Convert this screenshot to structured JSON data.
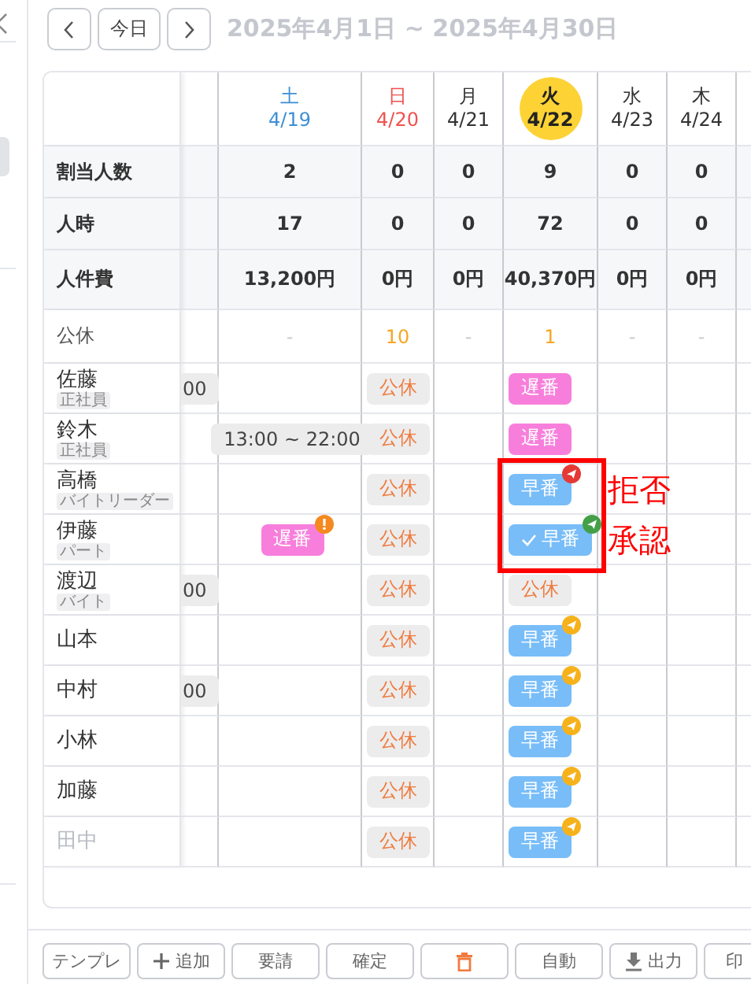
{
  "nav": {
    "today": "今日",
    "range": "2025年4月1日 ~ 2025年4月30日"
  },
  "days": [
    {
      "dow": "土",
      "date": "4/19",
      "kind": "sat",
      "selected": false
    },
    {
      "dow": "日",
      "date": "4/20",
      "kind": "sun",
      "selected": false
    },
    {
      "dow": "月",
      "date": "4/21",
      "kind": "weekday",
      "selected": false
    },
    {
      "dow": "火",
      "date": "4/22",
      "kind": "weekday",
      "selected": true
    },
    {
      "dow": "水",
      "date": "4/23",
      "kind": "weekday",
      "selected": false
    },
    {
      "dow": "木",
      "date": "4/24",
      "kind": "weekday",
      "selected": false
    }
  ],
  "summary": [
    {
      "label": "割当人数",
      "values": [
        "2",
        "0",
        "0",
        "9",
        "0",
        "0"
      ]
    },
    {
      "label": "人時",
      "values": [
        "17",
        "0",
        "0",
        "72",
        "0",
        "0"
      ]
    },
    {
      "label": "人件費",
      "values": [
        "13,200円",
        "0円",
        "0円",
        "40,370円",
        "0円",
        "0円"
      ]
    }
  ],
  "holidays": {
    "label": "公休",
    "cells": [
      {
        "text": "-",
        "highlight": false
      },
      {
        "text": "10",
        "highlight": true
      },
      {
        "text": "-",
        "highlight": false
      },
      {
        "text": "1",
        "highlight": true
      },
      {
        "text": "-",
        "highlight": false
      },
      {
        "text": "-",
        "highlight": false
      }
    ]
  },
  "employees": [
    {
      "name": "佐藤",
      "role": "正社員",
      "inactive": false,
      "partial": "00",
      "shifts": [
        {
          "kind": "empty"
        },
        {
          "label": "公休",
          "kind": "off"
        },
        {
          "kind": "empty"
        },
        {
          "label": "遅番",
          "kind": "late"
        },
        {
          "kind": "empty"
        },
        {
          "kind": "empty"
        }
      ]
    },
    {
      "name": "鈴木",
      "role": "正社員",
      "inactive": false,
      "shifts": [
        {
          "label": "13:00 ~ 22:00",
          "kind": "time"
        },
        {
          "label": "公休",
          "kind": "off"
        },
        {
          "kind": "empty"
        },
        {
          "label": "遅番",
          "kind": "late"
        },
        {
          "kind": "empty"
        },
        {
          "kind": "empty"
        }
      ]
    },
    {
      "name": "高橋",
      "role": "バイトリーダー",
      "inactive": false,
      "note": "拒否",
      "shifts": [
        {
          "kind": "empty"
        },
        {
          "label": "公休",
          "kind": "off"
        },
        {
          "kind": "empty"
        },
        {
          "label": "早番",
          "kind": "early",
          "checked": false,
          "badge": {
            "kind": "send",
            "color": "#e53935"
          }
        },
        {
          "kind": "empty"
        },
        {
          "kind": "empty"
        }
      ]
    },
    {
      "name": "伊藤",
      "role": "パート",
      "inactive": false,
      "note": "承認",
      "shifts": [
        {
          "label": "遅番",
          "kind": "late",
          "badge": {
            "kind": "alert",
            "color": "#f5891f"
          }
        },
        {
          "label": "公休",
          "kind": "off"
        },
        {
          "kind": "empty"
        },
        {
          "label": "早番",
          "kind": "early",
          "checked": true,
          "badge": {
            "kind": "send",
            "color": "#43a047"
          }
        },
        {
          "kind": "empty"
        },
        {
          "kind": "empty"
        }
      ]
    },
    {
      "name": "渡辺",
      "role": "バイト",
      "inactive": false,
      "partial": "00",
      "shifts": [
        {
          "kind": "empty"
        },
        {
          "label": "公休",
          "kind": "off"
        },
        {
          "kind": "empty"
        },
        {
          "label": "公休",
          "kind": "off"
        },
        {
          "kind": "empty"
        },
        {
          "kind": "empty"
        }
      ]
    },
    {
      "name": "山本",
      "inactive": false,
      "shifts": [
        {
          "kind": "empty"
        },
        {
          "label": "公休",
          "kind": "off"
        },
        {
          "kind": "empty"
        },
        {
          "label": "早番",
          "kind": "early",
          "checked": false,
          "badge": {
            "kind": "send",
            "color": "#f6b21b"
          }
        },
        {
          "kind": "empty"
        },
        {
          "kind": "empty"
        }
      ]
    },
    {
      "name": "中村",
      "inactive": false,
      "partial": "00",
      "shifts": [
        {
          "kind": "empty"
        },
        {
          "label": "公休",
          "kind": "off"
        },
        {
          "kind": "empty"
        },
        {
          "label": "早番",
          "kind": "early",
          "checked": false,
          "badge": {
            "kind": "send",
            "color": "#f6b21b"
          }
        },
        {
          "kind": "empty"
        },
        {
          "kind": "empty"
        }
      ]
    },
    {
      "name": "小林",
      "inactive": false,
      "shifts": [
        {
          "kind": "empty"
        },
        {
          "label": "公休",
          "kind": "off"
        },
        {
          "kind": "empty"
        },
        {
          "label": "早番",
          "kind": "early",
          "checked": false,
          "badge": {
            "kind": "send",
            "color": "#f6b21b"
          }
        },
        {
          "kind": "empty"
        },
        {
          "kind": "empty"
        }
      ]
    },
    {
      "name": "加藤",
      "inactive": false,
      "shifts": [
        {
          "kind": "empty"
        },
        {
          "label": "公休",
          "kind": "off"
        },
        {
          "kind": "empty"
        },
        {
          "label": "早番",
          "kind": "early",
          "checked": false,
          "badge": {
            "kind": "send",
            "color": "#f6b21b"
          }
        },
        {
          "kind": "empty"
        },
        {
          "kind": "empty"
        }
      ]
    },
    {
      "name": "田中",
      "inactive": true,
      "shifts": [
        {
          "kind": "empty"
        },
        {
          "label": "公休",
          "kind": "off"
        },
        {
          "kind": "empty"
        },
        {
          "label": "早番",
          "kind": "early",
          "checked": false,
          "badge": {
            "kind": "send",
            "color": "#f6b21b"
          }
        },
        {
          "kind": "empty"
        },
        {
          "kind": "empty"
        }
      ]
    }
  ],
  "toolbar": [
    {
      "kind": "text",
      "label": "テンプレ"
    },
    {
      "kind": "add",
      "label": "追加"
    },
    {
      "kind": "text",
      "label": "要請"
    },
    {
      "kind": "text",
      "label": "確定"
    },
    {
      "kind": "trash"
    },
    {
      "kind": "text",
      "label": "自動"
    },
    {
      "kind": "download",
      "label": "出力"
    },
    {
      "kind": "text",
      "label": "印"
    }
  ]
}
